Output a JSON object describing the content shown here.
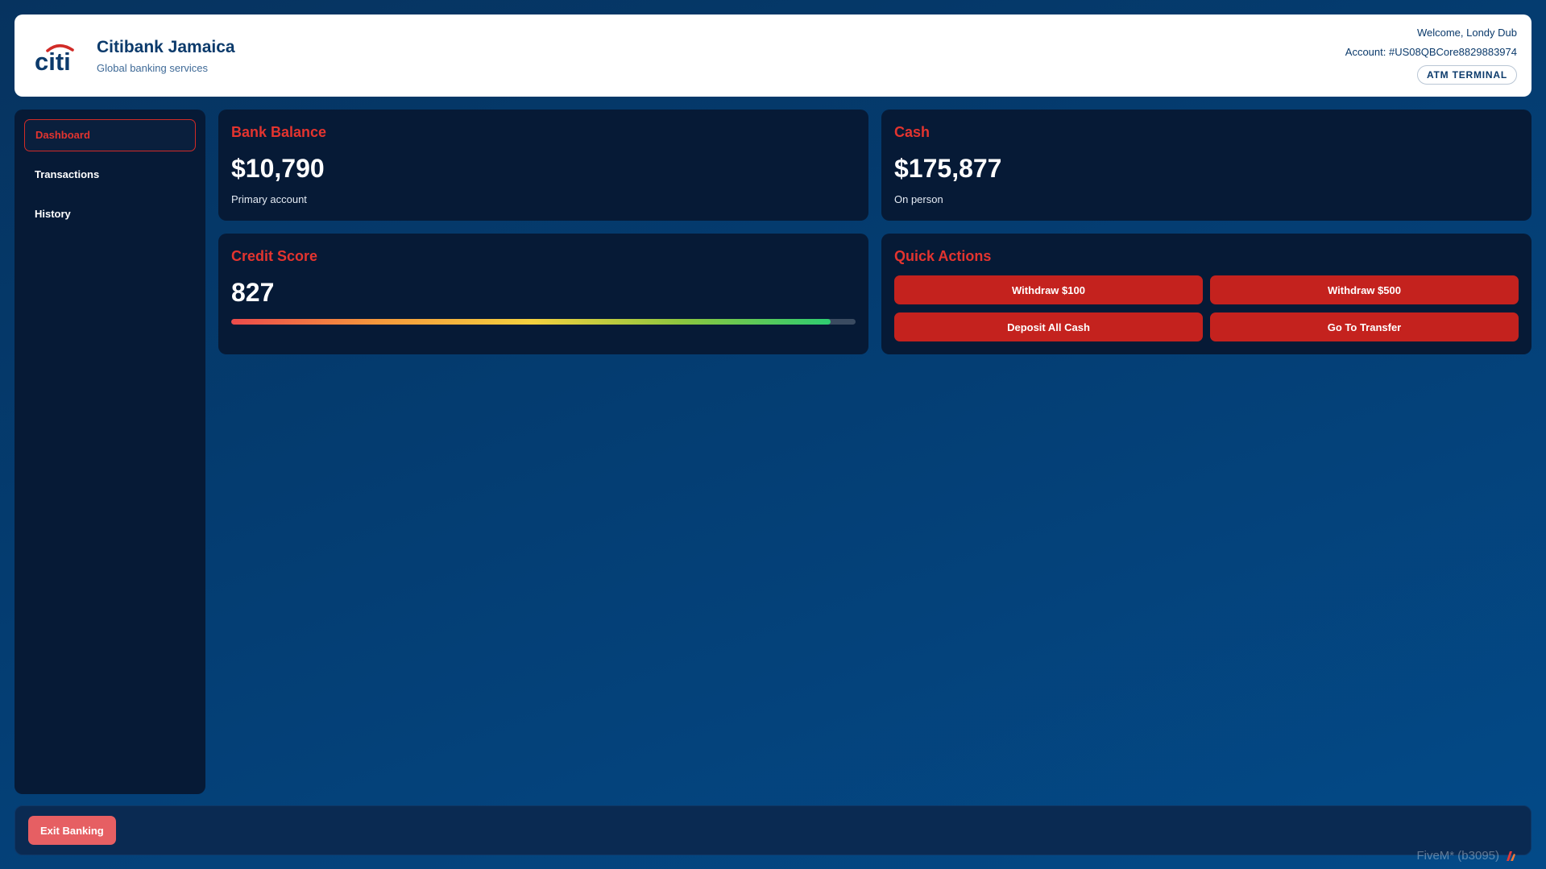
{
  "header": {
    "bank_name": "Citibank Jamaica",
    "tagline": "Global banking services",
    "welcome": "Welcome, Londy Dub",
    "account": "Account: #US08QBCore8829883974",
    "terminal_badge": "ATM TERMINAL",
    "logo_icon": "citi-logo",
    "logo_colors": {
      "text": "#0b3a6b",
      "arc": "#d12b27"
    }
  },
  "sidebar": {
    "items": [
      {
        "label": "Dashboard",
        "active": true
      },
      {
        "label": "Transactions",
        "active": false
      },
      {
        "label": "History",
        "active": false
      }
    ]
  },
  "cards": {
    "balance": {
      "title": "Bank Balance",
      "value": "$10,790",
      "subtitle": "Primary account"
    },
    "cash": {
      "title": "Cash",
      "value": "$175,877",
      "subtitle": "On person"
    },
    "credit": {
      "title": "Credit Score",
      "value": "827",
      "score_fraction": 0.96
    },
    "actions": {
      "title": "Quick Actions",
      "buttons": [
        "Withdraw $100",
        "Withdraw $500",
        "Deposit All Cash",
        "Go To Transfer"
      ]
    }
  },
  "footer": {
    "exit_label": "Exit Banking"
  },
  "watermark": {
    "text": "FiveM* (b3095)",
    "icon": "fivem-icon"
  },
  "colors": {
    "accent": "#e3342f",
    "button": "#c4221e",
    "exit_button": "#e65f63",
    "card_bg": "#061a36"
  }
}
